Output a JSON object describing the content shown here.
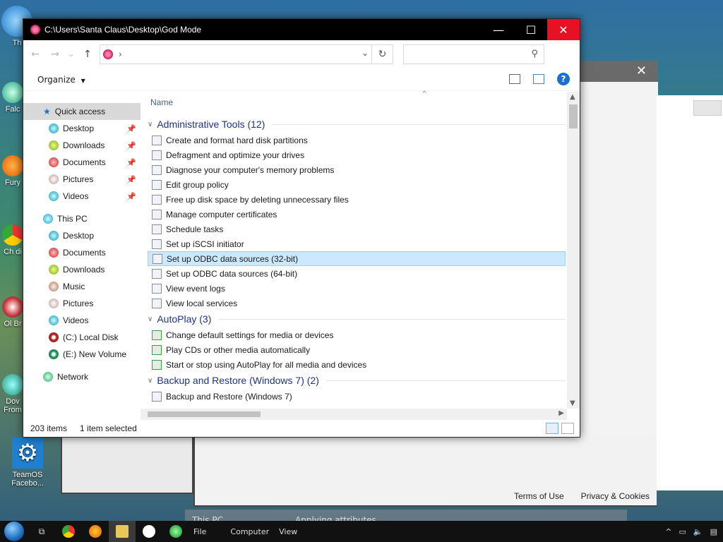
{
  "desktop": {
    "icons": [
      {
        "label": "Th"
      },
      {
        "label": "Falc"
      },
      {
        "label": "Fury"
      },
      {
        "label": "Ch di"
      },
      {
        "label": "Ol Br"
      },
      {
        "label": "Dov From"
      },
      {
        "label": "TeamOS Facebo..."
      }
    ]
  },
  "window": {
    "title": "C:\\Users\\Santa Claus\\Desktop\\God Mode",
    "controls": {
      "minimize": "—",
      "maximize": "☐",
      "close": "✕"
    }
  },
  "address": {
    "back_icon": "←",
    "forward_icon": "→",
    "recent_icon": "⌄",
    "up_icon": "↑",
    "crumb_sep": "›",
    "dropdown_icon": "⌄",
    "refresh_icon": "↻",
    "search_placeholder": "",
    "search_icon": "⚲"
  },
  "commandbar": {
    "organize": "Organize",
    "caret": "▼",
    "help": "?"
  },
  "nav": {
    "quick_access": "Quick access",
    "quick_items": [
      {
        "label": "Desktop"
      },
      {
        "label": "Downloads"
      },
      {
        "label": "Documents"
      },
      {
        "label": "Pictures"
      },
      {
        "label": "Videos"
      }
    ],
    "this_pc": "This PC",
    "pc_items": [
      {
        "label": "Desktop"
      },
      {
        "label": "Documents"
      },
      {
        "label": "Downloads"
      },
      {
        "label": "Music"
      },
      {
        "label": "Pictures"
      },
      {
        "label": "Videos"
      },
      {
        "label": "(C:) Local Disk"
      },
      {
        "label": "(E:) New Volume"
      }
    ],
    "network": "Network",
    "pin_icon": "📌"
  },
  "content": {
    "column_header": "Name",
    "sort_caret": "^",
    "groups": [
      {
        "title": "Administrative Tools (12)",
        "items": [
          "Create and format hard disk partitions",
          "Defragment and optimize your drives",
          "Diagnose your computer's memory problems",
          "Edit group policy",
          "Free up disk space by deleting unnecessary files",
          "Manage computer certificates",
          "Schedule tasks",
          "Set up iSCSI initiator",
          "Set up ODBC data sources (32-bit)",
          "Set up ODBC data sources (64-bit)",
          "View event logs",
          "View local services"
        ]
      },
      {
        "title": "AutoPlay (3)",
        "items": [
          "Change default settings for media or devices",
          "Play CDs or other media automatically",
          "Start or stop using AutoPlay for all media and devices"
        ]
      },
      {
        "title": "Backup and Restore (Windows 7) (2)",
        "items": [
          "Backup and Restore (Windows 7)"
        ]
      }
    ],
    "selected_item": "Set up ODBC data sources (32-bit)"
  },
  "status": {
    "count": "203 items",
    "selection": "1 item selected"
  },
  "background": {
    "close_icon": "✕",
    "terms": "Terms of Use",
    "privacy": "Privacy & Cookies",
    "ghost_label_1": "This PC",
    "ghost_label_2": "Applying attributes..."
  },
  "taskbar": {
    "items": [
      {
        "label": "File"
      },
      {
        "label": "Computer"
      },
      {
        "label": "View"
      }
    ]
  }
}
